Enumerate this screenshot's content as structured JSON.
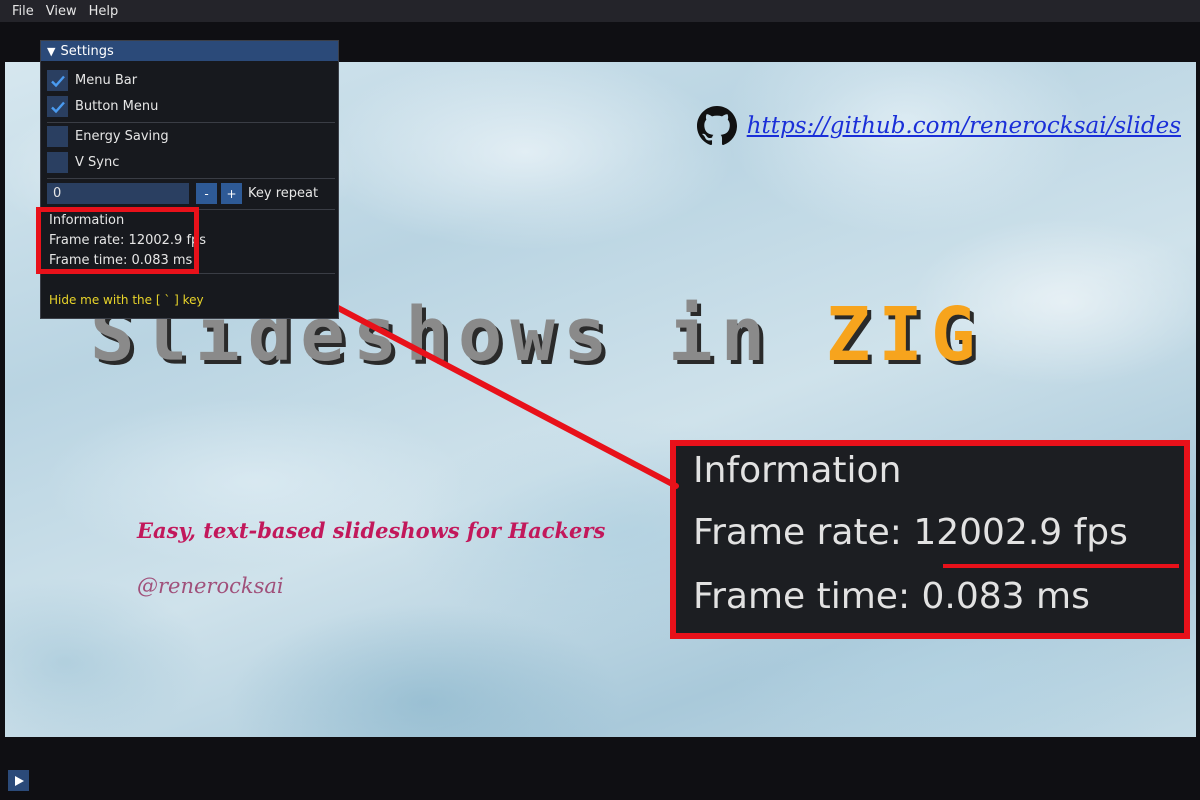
{
  "menu": [
    "File",
    "View",
    "Help"
  ],
  "slide": {
    "github_url": "https://github.com/renerocksai/slides",
    "title_main": "Slideshows in ",
    "title_accent": "ZIG",
    "subtitle": "Easy, text-based slideshows for Hackers",
    "handle": "@renerocksai"
  },
  "settings": {
    "title": "Settings",
    "checkboxes": [
      {
        "label": "Menu Bar",
        "checked": true
      },
      {
        "label": "Button Menu",
        "checked": true
      },
      {
        "label": "Energy Saving",
        "checked": false
      },
      {
        "label": "V Sync",
        "checked": false
      }
    ],
    "key_repeat_value": "0",
    "minus": "-",
    "plus": "+",
    "key_repeat_label": "Key repeat",
    "info_heading": "Information",
    "frame_rate": "Frame rate: 12002.9 fps",
    "frame_time": "Frame time:  0.083 ms",
    "hint": "Hide me with the [ ` ] key"
  },
  "zoom": {
    "info_heading": "Information",
    "frame_rate_label": "Frame rate: ",
    "frame_rate_value": "12002.9 fps",
    "frame_time": "Frame time:  0.083 ms"
  },
  "colors": {
    "annotation_red": "#e8111a",
    "zig_orange": "#f7a41d",
    "link_blue": "#1a2fd8",
    "subtitle_magenta": "#c2185b",
    "hint_yellow": "#e8d42a"
  }
}
